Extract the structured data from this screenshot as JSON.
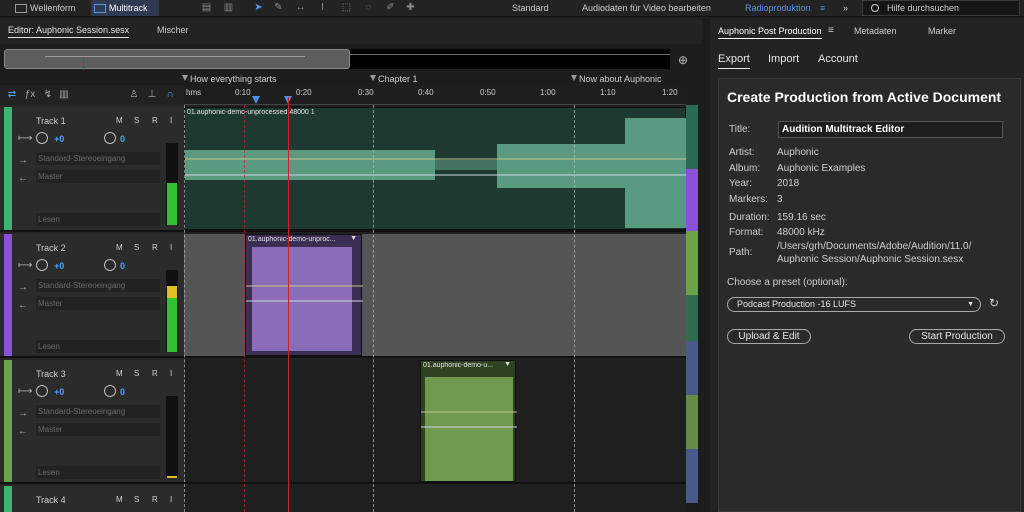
{
  "toolbar": {
    "waveform": "Wellenform",
    "multitrack": "Multitrack",
    "workspaces": [
      "Standard",
      "Audiodaten für Video bearbeiten",
      "Radioproduktion"
    ],
    "search_placeholder": "Hilfe durchsuchen"
  },
  "editor": {
    "tab_editor": "Editor: Auphonic Session.sesx",
    "tab_mixer": "Mischer"
  },
  "markers": [
    "How everything starts",
    "Chapter 1",
    "Now about Auphonic"
  ],
  "ruler": [
    "hms",
    "0:10",
    "0:20",
    "0:30",
    "0:40",
    "0:50",
    "1:00",
    "1:10",
    "1:20"
  ],
  "tracks": [
    {
      "name": "Track 1",
      "m": "M",
      "s": "S",
      "r": "R",
      "i": "I",
      "vol": "+0",
      "pan": "0",
      "input": "Standard-Stereoeingang",
      "output": "Master",
      "mode": "Lesen",
      "color": "#3cb371"
    },
    {
      "name": "Track 2",
      "m": "M",
      "s": "S",
      "r": "R",
      "i": "I",
      "vol": "+0",
      "pan": "0",
      "input": "Standard-Stereoeingang",
      "output": "Master",
      "mode": "Lesen",
      "color": "#8a52d8"
    },
    {
      "name": "Track 3",
      "m": "M",
      "s": "S",
      "r": "R",
      "i": "I",
      "vol": "+0",
      "pan": "0",
      "input": "Standard-Stereoeingang",
      "output": "Master",
      "mode": "Lesen",
      "color": "#6aa348"
    },
    {
      "name": "Track 4",
      "m": "M",
      "s": "S",
      "r": "R",
      "i": "I"
    }
  ],
  "clips": [
    "01.auphonic-demo-unprocessed 48000 1",
    "01.auphonic-demo-unproc...",
    "01.auphonic-demo-u..."
  ],
  "right": {
    "panel_tabs": [
      "Auphonic Post Production",
      "Metadaten",
      "Marker"
    ],
    "sub_tabs": [
      "Export",
      "Import",
      "Account"
    ],
    "heading": "Create Production from Active Document",
    "title_label": "Title:",
    "title_value": "Audition Multitrack Editor",
    "fields": [
      {
        "label": "Artist:",
        "value": "Auphonic"
      },
      {
        "label": "Album:",
        "value": "Auphonic Examples"
      },
      {
        "label": "Year:",
        "value": "2018"
      },
      {
        "label": "Markers:",
        "value": "3"
      },
      {
        "label": "Duration:",
        "value": "159.16 sec"
      },
      {
        "label": "Format:",
        "value": "48000 kHz"
      }
    ],
    "path_label": "Path:",
    "path_line1": "/Users/grh/Documents/Adobe/Audition/11.0/",
    "path_line2": "Auphonic Session/Auphonic Session.sesx",
    "preset_label": "Choose a preset (optional):",
    "preset_value": "Podcast Production -16 LUFS",
    "upload_button": "Upload & Edit",
    "start_button": "Start Production"
  }
}
